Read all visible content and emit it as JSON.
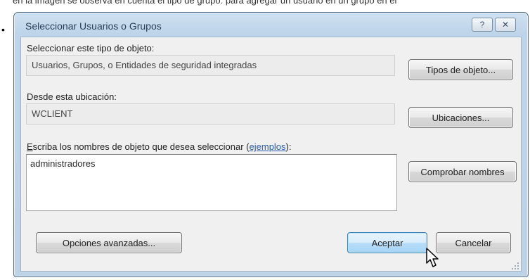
{
  "page": {
    "header_fragment": "en la imagen se observa en cuenta el tipo de grupo: para agregar un usuario en un grupo en el"
  },
  "dialog": {
    "title": "Seleccionar Usuarios o Grupos",
    "help_button": "?",
    "close_button": "✕",
    "object_type_label": "Seleccionar este tipo de objeto:",
    "object_type_value": "Usuarios, Grupos, o Entidades de seguridad integradas",
    "object_types_button": "Tipos de objeto...",
    "location_label": "Desde esta ubicación:",
    "location_value": "WCLIENT",
    "locations_button": "Ubicaciones...",
    "names_label_first_letter": "E",
    "names_label_rest": "scriba los nombres de objeto que desea seleccionar (",
    "examples_link": "ejemplos",
    "names_label_end": "):",
    "names_value": "administradores",
    "check_names_button": "Comprobar nombres",
    "advanced_button": "Opciones avanzadas...",
    "ok_button": "Aceptar",
    "cancel_button": "Cancelar"
  },
  "icons": {
    "cursor": "mouse-pointer-icon",
    "grip": "resize-grip-icon",
    "bullet": "bullet-icon"
  },
  "colors": {
    "title_bar": "#bfd3e6",
    "window_border": "#4d6a87",
    "client_background": "#f0f0f0",
    "link": "#2a5db0",
    "default_button_border": "#3c7fb1"
  }
}
